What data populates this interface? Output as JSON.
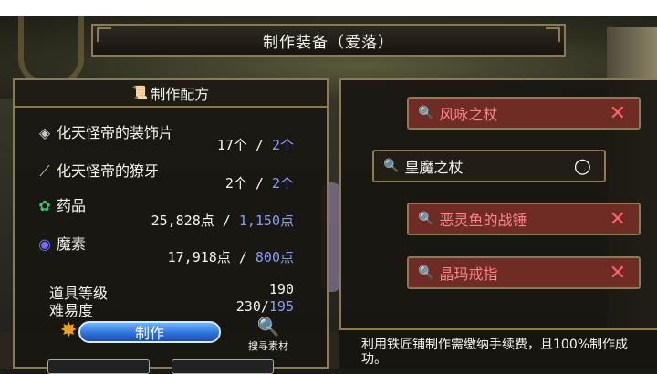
{
  "window": {
    "title": "制作装备（爱落）"
  },
  "recipe": {
    "header": "制作配方",
    "materials": [
      {
        "name": "化天怪帝的装饰片",
        "have": "17个",
        "sep": " / ",
        "need": "2个"
      },
      {
        "name": "化天怪帝的獠牙",
        "have": "2个",
        "sep": " / ",
        "need": "2个"
      },
      {
        "name": "药品",
        "have": "25,828点",
        "sep": " / ",
        "need": "1,150点"
      },
      {
        "name": "魔素",
        "have": "17,918点",
        "sep": " / ",
        "need": "800点"
      }
    ],
    "item_level_label": "道具等级",
    "item_level_value": "190",
    "difficulty_label": "难易度",
    "difficulty_have": "230/",
    "difficulty_need": "195",
    "craft_button": "制作",
    "search_label": "搜寻素材"
  },
  "items": [
    {
      "name": "风咏之杖",
      "status": "unavailable",
      "mark": "✕"
    },
    {
      "name": "皇魔之杖",
      "status": "available",
      "mark": "○"
    },
    {
      "name": "恶灵鱼的战锤",
      "status": "unavailable",
      "mark": "✕"
    },
    {
      "name": "晶玛戒指",
      "status": "unavailable",
      "mark": "✕"
    }
  ],
  "notice": "利用铁匠铺制作需缴纳手续费，且100%制作成功。",
  "icons": {
    "recipe_header": "recipe-scroll-icon",
    "material_0": "ornament-icon",
    "material_1": "fang-icon",
    "material_2": "herb-icon",
    "material_3": "mana-orb-icon",
    "item": "staff-icon",
    "craft": "hammer-icon",
    "search": "magnifier-icon"
  },
  "colors": {
    "frame": "#8b7a56",
    "need": "#8f9cf6",
    "unavailable_bg": "#6e2c24",
    "unavailable_text": "#ff8090"
  }
}
